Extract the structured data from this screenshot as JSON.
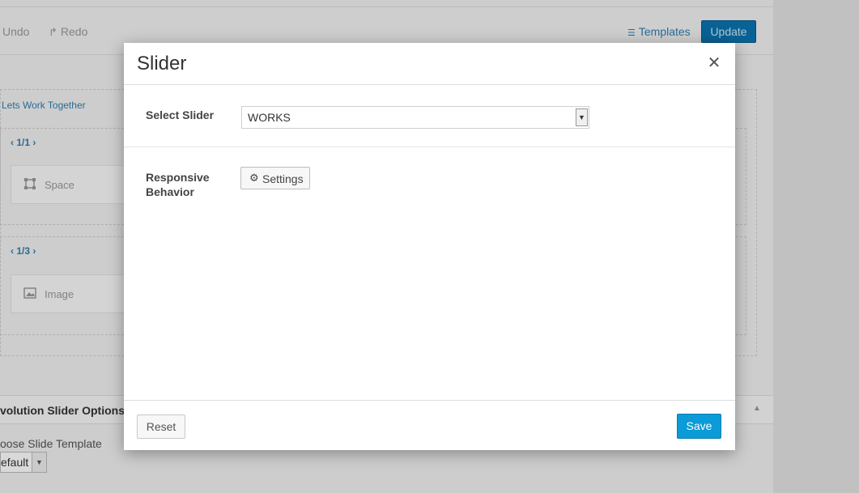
{
  "toolbar": {
    "undo_label": "Undo",
    "redo_icon": "redo-arrow-icon",
    "redo_label": "Redo",
    "templates_icon": "list-icon",
    "templates_label": "Templates",
    "update_label": "Update"
  },
  "builder": {
    "section_title": "Lets Work Together",
    "column1": {
      "nav": "1/1",
      "element_icon": "space-icon",
      "element_label": "Space"
    },
    "column2": {
      "nav": "1/3",
      "element_icon": "image-icon",
      "element_label": "Image"
    }
  },
  "revolution_panel": {
    "title": "volution Slider Options",
    "template_label": "oose Slide Template",
    "template_value": "efault"
  },
  "modal": {
    "title": "Slider",
    "close_icon": "close-icon",
    "select_slider": {
      "label": "Select Slider",
      "value": "WORKS"
    },
    "responsive": {
      "label_line1": "Responsive",
      "label_line2": "Behavior",
      "button_icon": "gear-icon",
      "button_label": "Settings"
    },
    "reset_label": "Reset",
    "save_label": "Save"
  },
  "colors": {
    "primary_button": "#0a9bd8",
    "update_button": "#0a74b0",
    "link": "#2e7fb3"
  }
}
